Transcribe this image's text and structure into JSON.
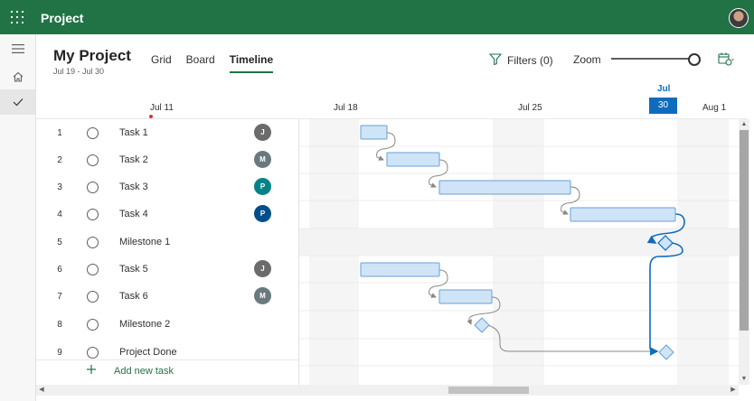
{
  "app": {
    "title": "Project"
  },
  "project": {
    "name": "My Project",
    "dates": "Jul 19 - Jul 30"
  },
  "tabs": [
    {
      "label": "Grid",
      "active": false
    },
    {
      "label": "Board",
      "active": false
    },
    {
      "label": "Timeline",
      "active": true
    }
  ],
  "toolbar": {
    "filters_label": "Filters (0)",
    "zoom_label": "Zoom",
    "zoom_level": 1.0
  },
  "timeline_header": {
    "dates": [
      "Jul 11",
      "Jul 18",
      "Jul 25",
      "Aug 1"
    ],
    "today_month": "Jul",
    "today_day": "30"
  },
  "tasks": [
    {
      "num": "1",
      "name": "Task 1",
      "assignee": "J",
      "avatar_color": "#6b6b6b",
      "type": "task"
    },
    {
      "num": "2",
      "name": "Task 2",
      "assignee": "M",
      "avatar_color": "#69797e",
      "type": "task"
    },
    {
      "num": "3",
      "name": "Task 3",
      "assignee": "P",
      "avatar_color": "#038387",
      "type": "task"
    },
    {
      "num": "4",
      "name": "Task 4",
      "assignee": "P",
      "avatar_color": "#004e8c",
      "type": "task"
    },
    {
      "num": "5",
      "name": "Milestone 1",
      "assignee": "",
      "avatar_color": "",
      "type": "milestone"
    },
    {
      "num": "6",
      "name": "Task 5",
      "assignee": "J",
      "avatar_color": "#6b6b6b",
      "type": "task"
    },
    {
      "num": "7",
      "name": "Task 6",
      "assignee": "M",
      "avatar_color": "#69797e",
      "type": "task"
    },
    {
      "num": "8",
      "name": "Milestone 2",
      "assignee": "",
      "avatar_color": "",
      "type": "milestone"
    },
    {
      "num": "9",
      "name": "Project Done",
      "assignee": "",
      "avatar_color": "",
      "type": "milestone"
    }
  ],
  "add_task_label": "Add new task",
  "colors": {
    "brand": "#217346",
    "accent": "#0f6cbd",
    "bar_fill": "#cfe4f7",
    "bar_stroke": "#6a9fd4",
    "weekend": "#f5f5f5"
  },
  "icons": {
    "app_launcher": "waffle-icon",
    "menu": "hamburger-icon",
    "home": "home-icon",
    "tasks": "checkmark-icon",
    "filter": "filter-icon",
    "calendar": "calendar-settings-icon",
    "add": "plus-icon"
  }
}
